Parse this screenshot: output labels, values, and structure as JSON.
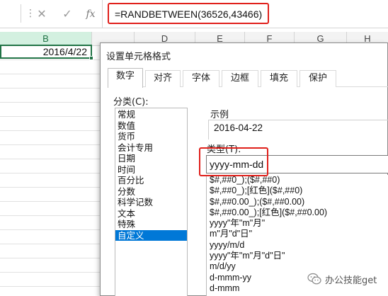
{
  "formula_bar": {
    "cancel_icon": "✕",
    "enter_icon": "✓",
    "fx_label": "fx",
    "formula": "=RANDBETWEEN(36526,43466)"
  },
  "columns": {
    "b": "B",
    "d": "D",
    "e": "E",
    "f": "F",
    "g": "G",
    "h": "H"
  },
  "cell": {
    "value": "2016/4/22"
  },
  "dialog": {
    "title": "设置单元格格式",
    "tabs": [
      "数字",
      "对齐",
      "字体",
      "边框",
      "填充",
      "保护"
    ],
    "active_tab": "数字",
    "category_label": "分类(C):",
    "categories": [
      "常规",
      "数值",
      "货币",
      "会计专用",
      "日期",
      "时间",
      "百分比",
      "分数",
      "科学记数",
      "文本",
      "特殊",
      "自定义"
    ],
    "selected_category": "自定义",
    "sample_label": "示例",
    "sample_value": "2016-04-22",
    "type_label": "类型(T):",
    "type_value": "yyyy-mm-dd",
    "formats": [
      "$#,##0_);($#,##0)",
      "$#,##0_);[红色]($#,##0)",
      "$#,##0.00_);($#,##0.00)",
      "$#,##0.00_);[红色]($#,##0.00)",
      "yyyy\"年\"m\"月\"",
      "m\"月\"d\"日\"",
      "yyyy/m/d",
      "yyyy\"年\"m\"月\"d\"日\"",
      "m/d/yy",
      "d-mmm-yy",
      "d-mmm"
    ]
  },
  "watermark": {
    "text": "办公技能get"
  },
  "colors": {
    "highlight_red": "#e0201b",
    "excel_green": "#217346",
    "selection_blue": "#0078d7"
  }
}
